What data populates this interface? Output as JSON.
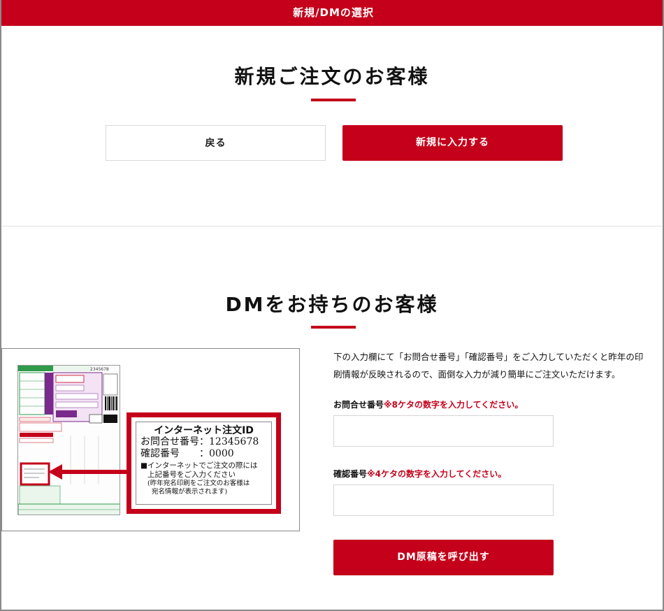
{
  "header": {
    "title": "新規/DMの選択"
  },
  "new_section": {
    "title": "新規ご注文のお客様",
    "back_label": "戻る",
    "new_label": "新規に入力する"
  },
  "dm_section": {
    "title": "DMをお持ちのお客様",
    "description_line1": "下の入力欄にて「お問合せ番号」「確認番号」をご入力していただくと昨年の印",
    "description_line2": "刷情報が反映されるので、面倒な入力が減り簡単にご注文いただけます。",
    "inquiry_label": "お問合せ番号",
    "inquiry_note": "※8ケタの数字を入力してください。",
    "inquiry_value": "",
    "confirm_label": "確認番号",
    "confirm_note": "※4ケタの数字を入力してください。",
    "confirm_value": "",
    "submit_label": "DM原稿を呼び出す"
  },
  "sample_image": {
    "callout_title": "インターネット注文ID",
    "inquiry_caption": "お問合せ番号：12345678",
    "confirm_caption": "確認番号　　：0000",
    "note_line1": "■インターネットでご注文の際には",
    "note_line2": "上記番号をご入力ください",
    "note_line3": "(昨年宛名印刷をご注文のお客様は",
    "note_line4": "宛名情報が表示されます)",
    "form_number": "2345678"
  },
  "colors": {
    "brand_red": "#c4001a",
    "form_green": "#2e9a4a",
    "form_purple": "#7a2a8c"
  }
}
